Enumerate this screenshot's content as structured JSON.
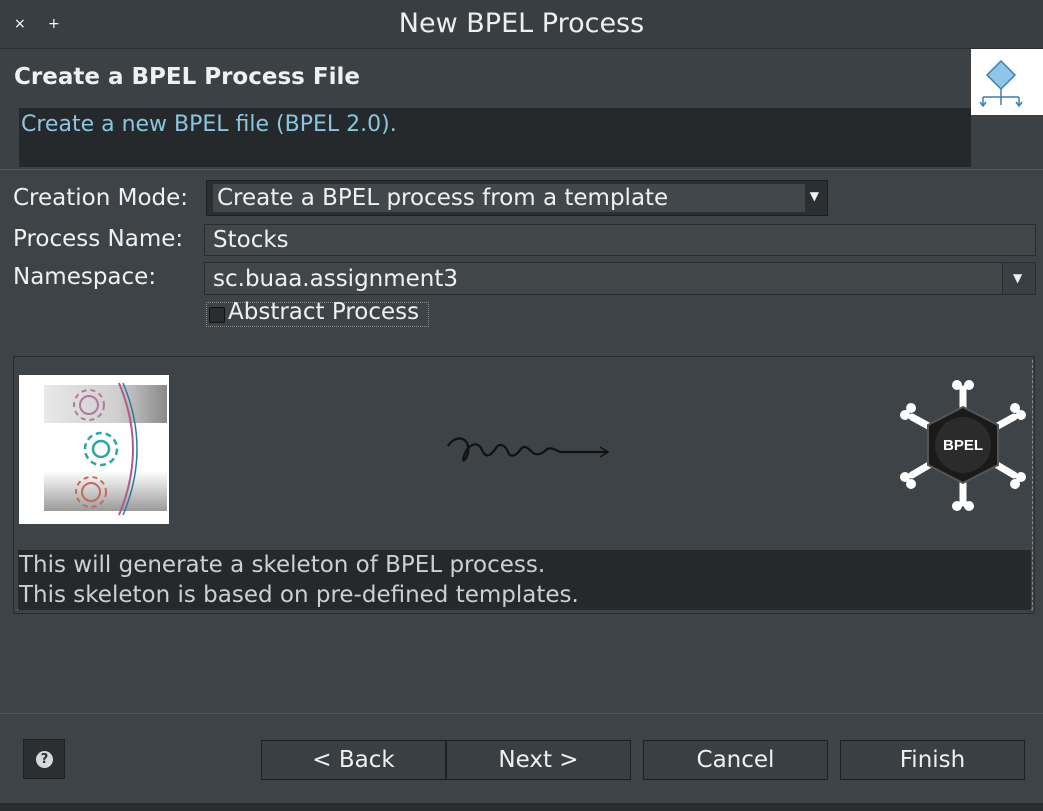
{
  "window": {
    "title": "New BPEL Process",
    "close_label": "×",
    "maximize_label": "+"
  },
  "header": {
    "title": "Create a BPEL Process File",
    "message": "Create a new BPEL file (BPEL 2.0)."
  },
  "form": {
    "creation_mode_label": "Creation Mode:",
    "creation_mode_value": "Create a BPEL process from a template",
    "process_name_label": "Process Name:",
    "process_name_value": "Stocks",
    "namespace_label": "Namespace:",
    "namespace_value": "sc.buaa.assignment3",
    "abstract_label": "Abstract Process",
    "abstract_checked": false
  },
  "template": {
    "logo_text": "BPEL",
    "description_line1": "This will generate a skeleton of BPEL process.",
    "description_line2": "This skeleton is based on pre-defined templates."
  },
  "buttons": {
    "help": "?",
    "back": "< Back",
    "next": "Next >",
    "cancel": "Cancel",
    "finish": "Finish"
  },
  "colors": {
    "background": "#3e4347",
    "message_text": "#8ac6de",
    "field_dark": "#26292c"
  }
}
